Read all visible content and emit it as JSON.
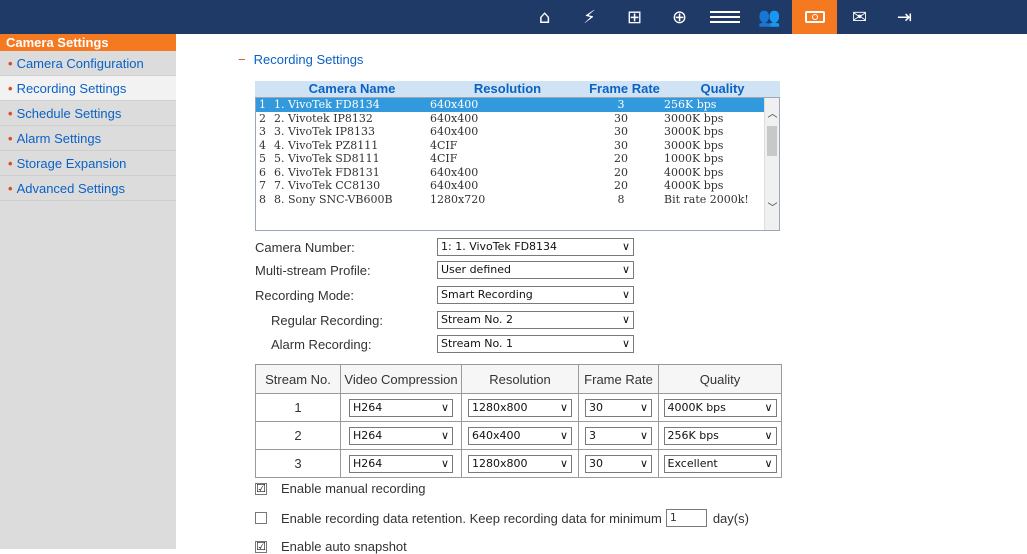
{
  "topbar": {
    "icons": [
      {
        "name": "home-icon",
        "glyph": "⌂"
      },
      {
        "name": "lightning-icon",
        "glyph": "⚡"
      },
      {
        "name": "network-icon",
        "glyph": "⊞"
      },
      {
        "name": "plugin-icon",
        "glyph": "⊕"
      },
      {
        "name": "list-icon",
        "glyph": "≡"
      },
      {
        "name": "users-icon",
        "glyph": "👥"
      },
      {
        "name": "camera-icon",
        "glyph": "◎"
      },
      {
        "name": "mail-icon",
        "glyph": "✉"
      },
      {
        "name": "exit-icon",
        "glyph": "⇥"
      }
    ]
  },
  "sidebar": {
    "title": "Camera Settings",
    "items": [
      {
        "label": "Camera Configuration"
      },
      {
        "label": "Recording Settings"
      },
      {
        "label": "Schedule Settings"
      },
      {
        "label": "Alarm Settings"
      },
      {
        "label": "Storage Expansion"
      },
      {
        "label": "Advanced Settings"
      }
    ]
  },
  "section": {
    "minus": "−",
    "title": "Recording Settings"
  },
  "camera_list": {
    "headers": {
      "name": "Camera Name",
      "resolution": "Resolution",
      "frame_rate": "Frame Rate",
      "quality": "Quality"
    },
    "rows": [
      {
        "idx": "1",
        "name": "1. VivoTek FD8134",
        "resolution": "640x400",
        "frame_rate": "3",
        "quality": "256K bps"
      },
      {
        "idx": "2",
        "name": "2. Vivotek IP8132",
        "resolution": "640x400",
        "frame_rate": "30",
        "quality": "3000K bps"
      },
      {
        "idx": "3",
        "name": "3. VivoTek IP8133",
        "resolution": "640x400",
        "frame_rate": "30",
        "quality": "3000K bps"
      },
      {
        "idx": "4",
        "name": "4. VivoTek PZ8111",
        "resolution": "4CIF",
        "frame_rate": "30",
        "quality": "3000K bps"
      },
      {
        "idx": "5",
        "name": "5. VivoTek SD8111",
        "resolution": "4CIF",
        "frame_rate": "20",
        "quality": "1000K bps"
      },
      {
        "idx": "6",
        "name": "6. VivoTek FD8131",
        "resolution": "640x400",
        "frame_rate": "20",
        "quality": "4000K bps"
      },
      {
        "idx": "7",
        "name": "7. VivoTek CC8130",
        "resolution": "640x400",
        "frame_rate": "20",
        "quality": "4000K bps"
      },
      {
        "idx": "8",
        "name": "8. Sony SNC-VB600B",
        "resolution": "1280x720",
        "frame_rate": "8",
        "quality": "Bit rate 2000k!"
      }
    ]
  },
  "form": {
    "camera_number": {
      "label": "Camera Number:",
      "value": "1: 1. VivoTek FD8134"
    },
    "multistream": {
      "label": "Multi-stream Profile:",
      "value": "User defined"
    },
    "recording_mode": {
      "label": "Recording Mode:",
      "value": "Smart Recording"
    },
    "regular": {
      "label": "Regular Recording:",
      "value": "Stream No. 2"
    },
    "alarm": {
      "label": "Alarm Recording:",
      "value": "Stream No. 1"
    }
  },
  "stream_table": {
    "headers": {
      "no": "Stream No.",
      "compression": "Video Compression",
      "resolution": "Resolution",
      "frame_rate": "Frame Rate",
      "quality": "Quality"
    },
    "rows": [
      {
        "no": "1",
        "compression": "H264",
        "resolution": "1280x800",
        "frame_rate": "30",
        "quality": "4000K bps"
      },
      {
        "no": "2",
        "compression": "H264",
        "resolution": "640x400",
        "frame_rate": "3",
        "quality": "256K bps"
      },
      {
        "no": "3",
        "compression": "H264",
        "resolution": "1280x800",
        "frame_rate": "30",
        "quality": "Excellent"
      }
    ]
  },
  "options": {
    "manual": {
      "checked": "☑",
      "label": "Enable manual recording"
    },
    "retention": {
      "checked": "",
      "label_before": "Enable recording data retention. Keep recording data for minimum",
      "value": "1",
      "label_after": "day(s)"
    },
    "snapshot": {
      "checked": "☑",
      "label": "Enable auto snapshot"
    }
  },
  "colors": {
    "topbar": "#1f3a66",
    "accent": "#f47920",
    "link": "#0b62c4",
    "selected_row": "#3399dd"
  }
}
